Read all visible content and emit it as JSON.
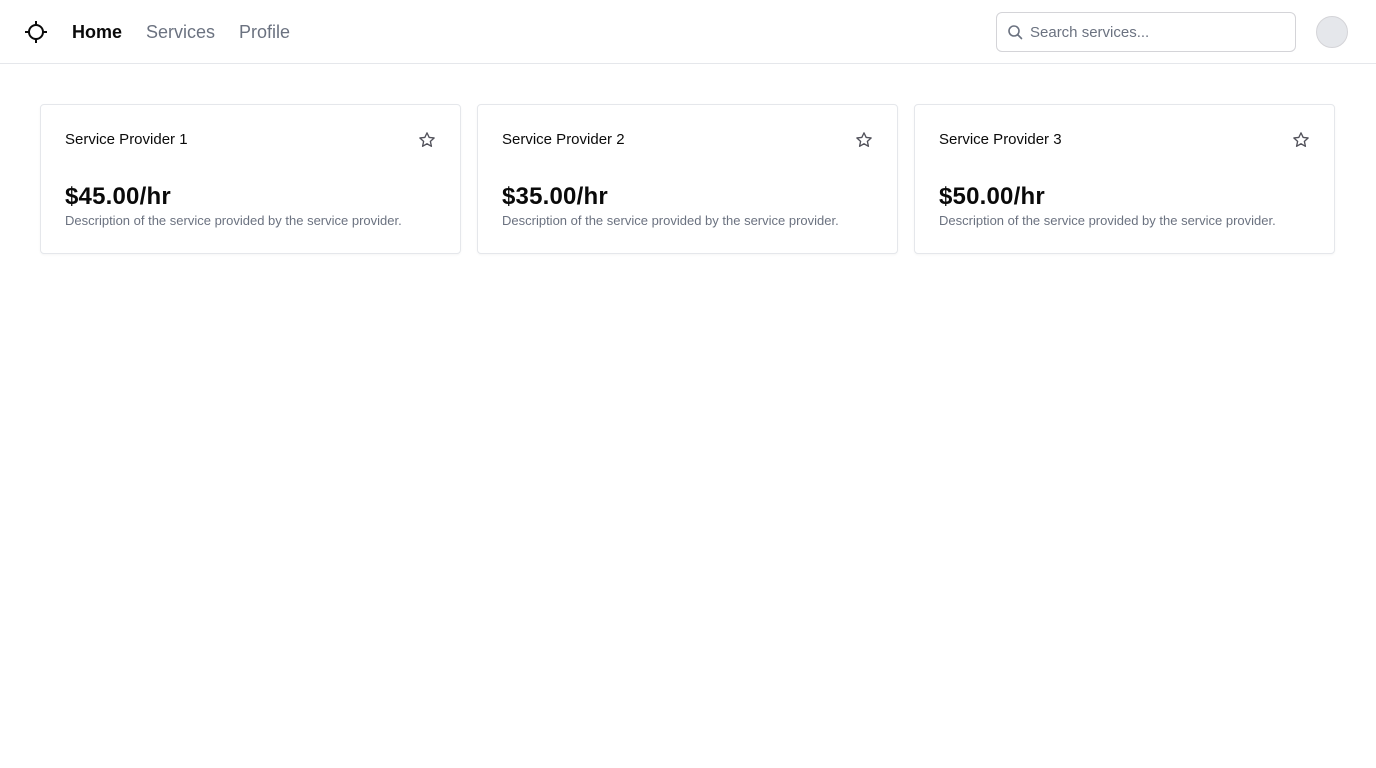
{
  "header": {
    "logo_icon": "crosshair-icon",
    "nav": [
      {
        "label": "Home",
        "active": true
      },
      {
        "label": "Services",
        "active": false
      },
      {
        "label": "Profile",
        "active": false
      }
    ],
    "search": {
      "placeholder": "Search services...",
      "value": "",
      "icon": "search-icon"
    },
    "avatar_icon": "avatar"
  },
  "cards": [
    {
      "title": "Service Provider 1",
      "price": "$45.00/hr",
      "description": "Description of the service provided by the service provider.",
      "favorite_icon": "star-icon"
    },
    {
      "title": "Service Provider 2",
      "price": "$35.00/hr",
      "description": "Description of the service provided by the service provider.",
      "favorite_icon": "star-icon"
    },
    {
      "title": "Service Provider 3",
      "price": "$50.00/hr",
      "description": "Description of the service provided by the service provider.",
      "favorite_icon": "star-icon"
    }
  ],
  "colors": {
    "text": "#0a0a0a",
    "muted": "#6b7280",
    "border": "#e5e7eb",
    "avatar_bg": "#e5e7eb"
  }
}
